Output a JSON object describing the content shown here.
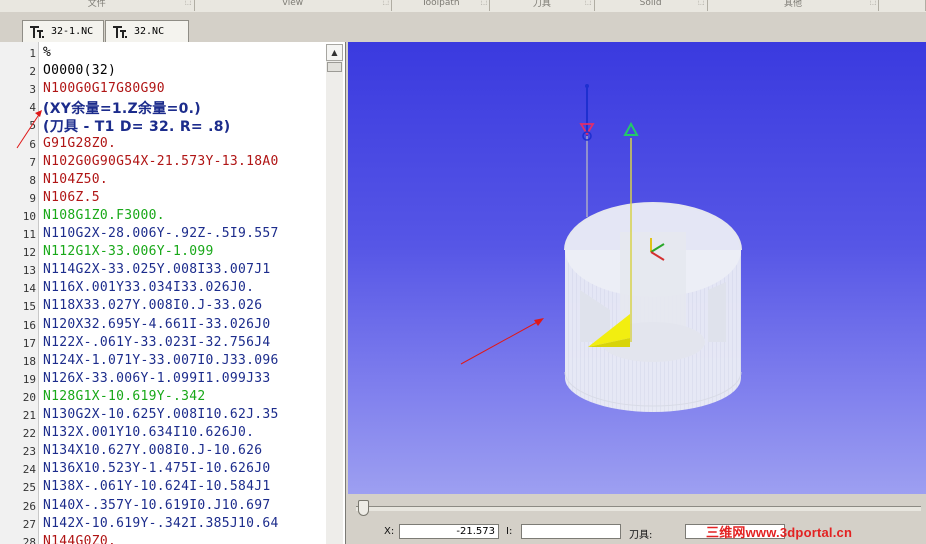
{
  "toolbar": {
    "groups": [
      {
        "label": "文件"
      },
      {
        "label": "view"
      },
      {
        "label": "Toolpath"
      },
      {
        "label": "刀具"
      },
      {
        "label": "Solid"
      },
      {
        "label": "其他"
      }
    ]
  },
  "tabs": [
    {
      "label": "32-1.NC"
    },
    {
      "label": "32.NC"
    }
  ],
  "editor": {
    "lines": [
      {
        "num": "1",
        "text": "%",
        "color": "#000000"
      },
      {
        "num": "2",
        "text": "O0000(32)",
        "color": "#000000"
      },
      {
        "num": "3",
        "text": "N100G0G17G80G90",
        "color": "#b01515"
      },
      {
        "num": "4",
        "text": "(XY余量=1.Z余量=0.)",
        "color": "#1c2c8c",
        "big": true
      },
      {
        "num": "5",
        "text": "(刀具 - T1 D= 32. R= .8)",
        "color": "#1c2c8c",
        "big": true
      },
      {
        "num": "6",
        "text": "G91G28Z0.",
        "color": "#b01515"
      },
      {
        "num": "7",
        "text": "N102G0G90G54X-21.573Y-13.18A0",
        "color": "#b01515"
      },
      {
        "num": "8",
        "text": "N104Z50.",
        "color": "#b01515"
      },
      {
        "num": "9",
        "text": "N106Z.5",
        "color": "#b01515"
      },
      {
        "num": "10",
        "text": "N108G1Z0.F3000.",
        "color": "#18a818"
      },
      {
        "num": "11",
        "text": "N110G2X-28.006Y-.92Z-.5I9.557",
        "color": "#1c2c8c"
      },
      {
        "num": "12",
        "text": "N112G1X-33.006Y-1.099",
        "color": "#18a818"
      },
      {
        "num": "13",
        "text": "N114G2X-33.025Y.008I33.007J1",
        "color": "#1c2c8c"
      },
      {
        "num": "14",
        "text": "N116X.001Y33.034I33.026J0.",
        "color": "#1c2c8c"
      },
      {
        "num": "15",
        "text": "N118X33.027Y.008I0.J-33.026",
        "color": "#1c2c8c"
      },
      {
        "num": "16",
        "text": "N120X32.695Y-4.661I-33.026J0",
        "color": "#1c2c8c"
      },
      {
        "num": "17",
        "text": "N122X-.061Y-33.023I-32.756J4",
        "color": "#1c2c8c"
      },
      {
        "num": "18",
        "text": "N124X-1.071Y-33.007I0.J33.096",
        "color": "#1c2c8c"
      },
      {
        "num": "19",
        "text": "N126X-33.006Y-1.099I1.099J33",
        "color": "#1c2c8c"
      },
      {
        "num": "20",
        "text": "N128G1X-10.619Y-.342",
        "color": "#18a818"
      },
      {
        "num": "21",
        "text": "N130G2X-10.625Y.008I10.62J.35",
        "color": "#1c2c8c"
      },
      {
        "num": "22",
        "text": "N132X.001Y10.634I10.626J0.",
        "color": "#1c2c8c"
      },
      {
        "num": "23",
        "text": "N134X10.627Y.008I0.J-10.626",
        "color": "#1c2c8c"
      },
      {
        "num": "24",
        "text": "N136X10.523Y-1.475I-10.626J0",
        "color": "#1c2c8c"
      },
      {
        "num": "25",
        "text": "N138X-.061Y-10.624I-10.584J1",
        "color": "#1c2c8c"
      },
      {
        "num": "26",
        "text": "N140X-.357Y-10.619I0.J10.697",
        "color": "#1c2c8c"
      },
      {
        "num": "27",
        "text": "N142X-10.619Y-.342I.385J10.64",
        "color": "#1c2c8c"
      },
      {
        "num": "28",
        "text": "N144G0Z0.",
        "color": "#b01515"
      }
    ]
  },
  "status": {
    "x_label": "X:",
    "x_value": "-21.573",
    "i_label": "I:",
    "i_value": "",
    "tool_label": "刀具:",
    "tool_value": ""
  },
  "watermark": "三维网www.3dportal.cn"
}
